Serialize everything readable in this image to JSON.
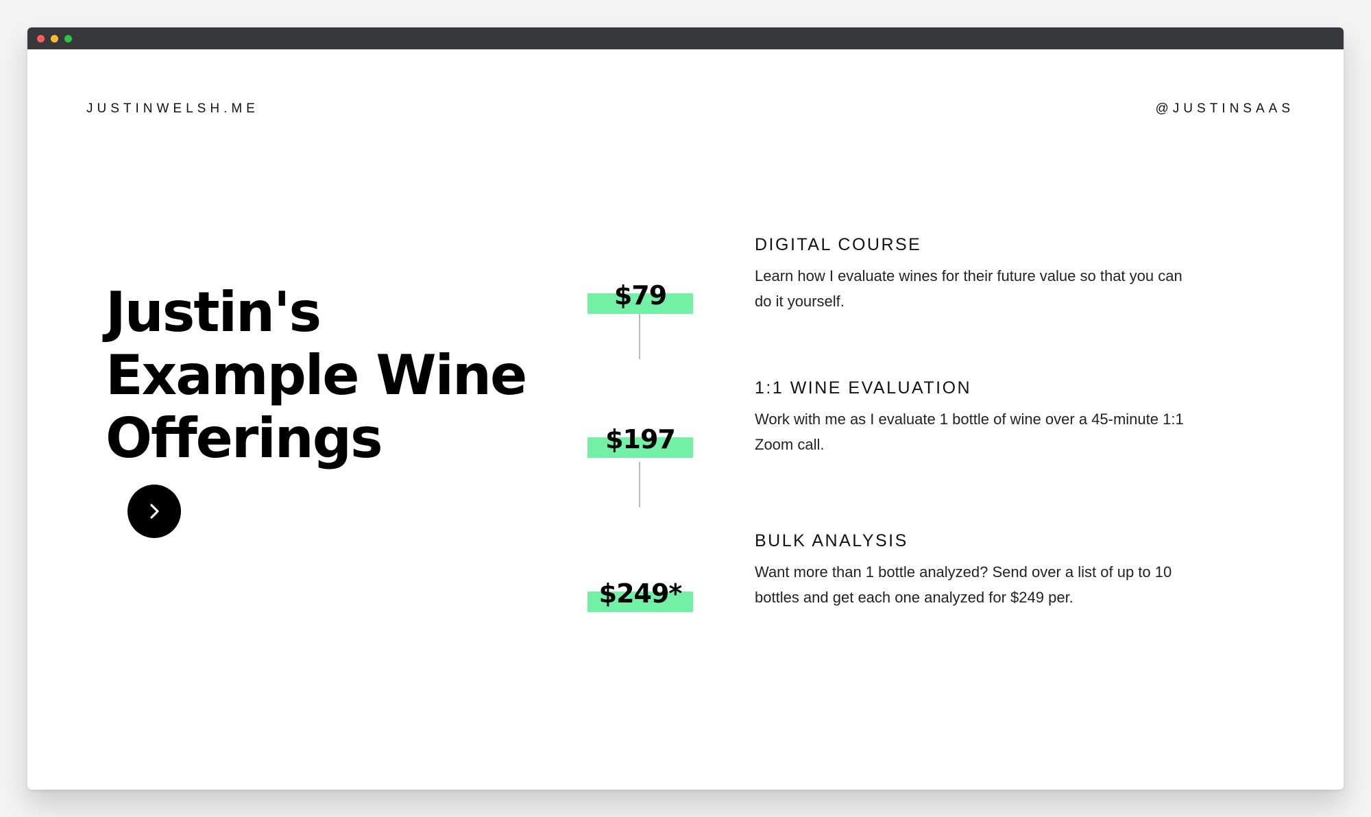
{
  "header": {
    "site_name": "JUSTINWELSH.ME",
    "handle": "@JUSTINSAAS"
  },
  "hero": {
    "title_lines": [
      "Justin's",
      "Example Wine",
      "Offerings"
    ]
  },
  "colors": {
    "accent_green": "#72f0a6",
    "titlebar": "#37383b",
    "text": "#000000"
  },
  "icons": {
    "next_button": "chevron-right-icon"
  },
  "offerings": [
    {
      "price": "$79",
      "title": "DIGITAL COURSE",
      "description": "Learn how I evaluate wines for their future value so that you can do it yourself."
    },
    {
      "price": "$197",
      "title": "1:1 WINE EVALUATION",
      "description": "Work with me as I evaluate 1 bottle of wine over a 45-minute 1:1 Zoom call."
    },
    {
      "price": "$249*",
      "title": "BULK ANALYSIS",
      "description": "Want more than 1 bottle analyzed? Send over a list of up to 10 bottles and get each one analyzed for $249 per."
    }
  ]
}
